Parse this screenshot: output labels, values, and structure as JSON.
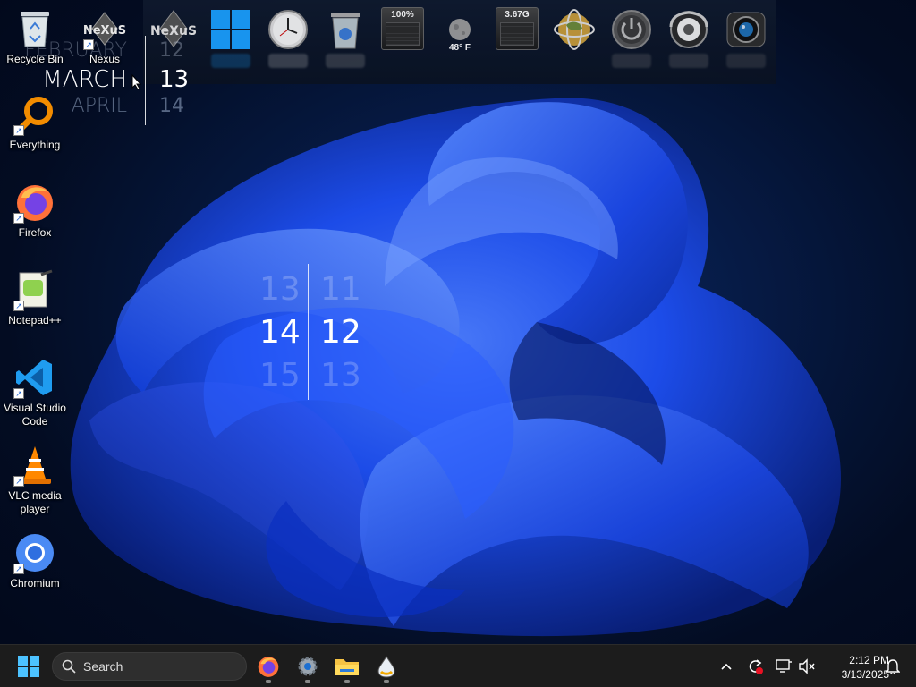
{
  "desktop_icons": [
    {
      "label": "Recycle Bin",
      "icon": "recycle-bin-icon",
      "shortcut": false
    },
    {
      "label": "Nexus",
      "icon": "nexus-icon",
      "shortcut": true
    },
    {
      "label": "Everything",
      "icon": "everything-search-icon",
      "shortcut": true
    },
    {
      "label": "Firefox",
      "icon": "firefox-icon",
      "shortcut": true
    },
    {
      "label": "Notepad++",
      "icon": "notepad-plus-plus-icon",
      "shortcut": true
    },
    {
      "label": "Visual Studio Code",
      "icon": "vscode-icon",
      "shortcut": true
    },
    {
      "label": "VLC media player",
      "icon": "vlc-icon",
      "shortcut": true
    },
    {
      "label": "Chromium",
      "icon": "chromium-icon",
      "shortcut": true
    }
  ],
  "dock": {
    "nexus_logo": "NeXuS",
    "cpu_meter": "100%",
    "weather_temp": "48° F",
    "memory_meter": "3.67G",
    "items": [
      "nexus-logo-icon",
      "windows-logo-icon",
      "clock-icon",
      "recycle-bin-icon",
      "cpu-meter-icon",
      "weather-moon-icon",
      "memory-meter-icon",
      "globe-icon",
      "power-icon",
      "speaker-icon",
      "webcam-icon"
    ]
  },
  "calendar_widget": {
    "prev_month": "FEBRUARY",
    "current_month": "MARCH",
    "next_month": "APRIL",
    "prev_day": "12",
    "current_day": "13",
    "next_day": "14"
  },
  "clock_widget": {
    "hours": [
      "13",
      "14",
      "15"
    ],
    "minutes": [
      "11",
      "12",
      "13"
    ]
  },
  "taskbar": {
    "search_placeholder": "Search",
    "apps": [
      "firefox-icon",
      "settings-gear-icon",
      "file-explorer-icon",
      "inkscape-drop-icon"
    ],
    "time": "2:12 PM",
    "date": "3/13/2025"
  },
  "colors": {
    "taskbar_bg": "#1c1c1c",
    "accent_blue": "#1d5cff",
    "windows_blue": "#1aa0ff"
  }
}
